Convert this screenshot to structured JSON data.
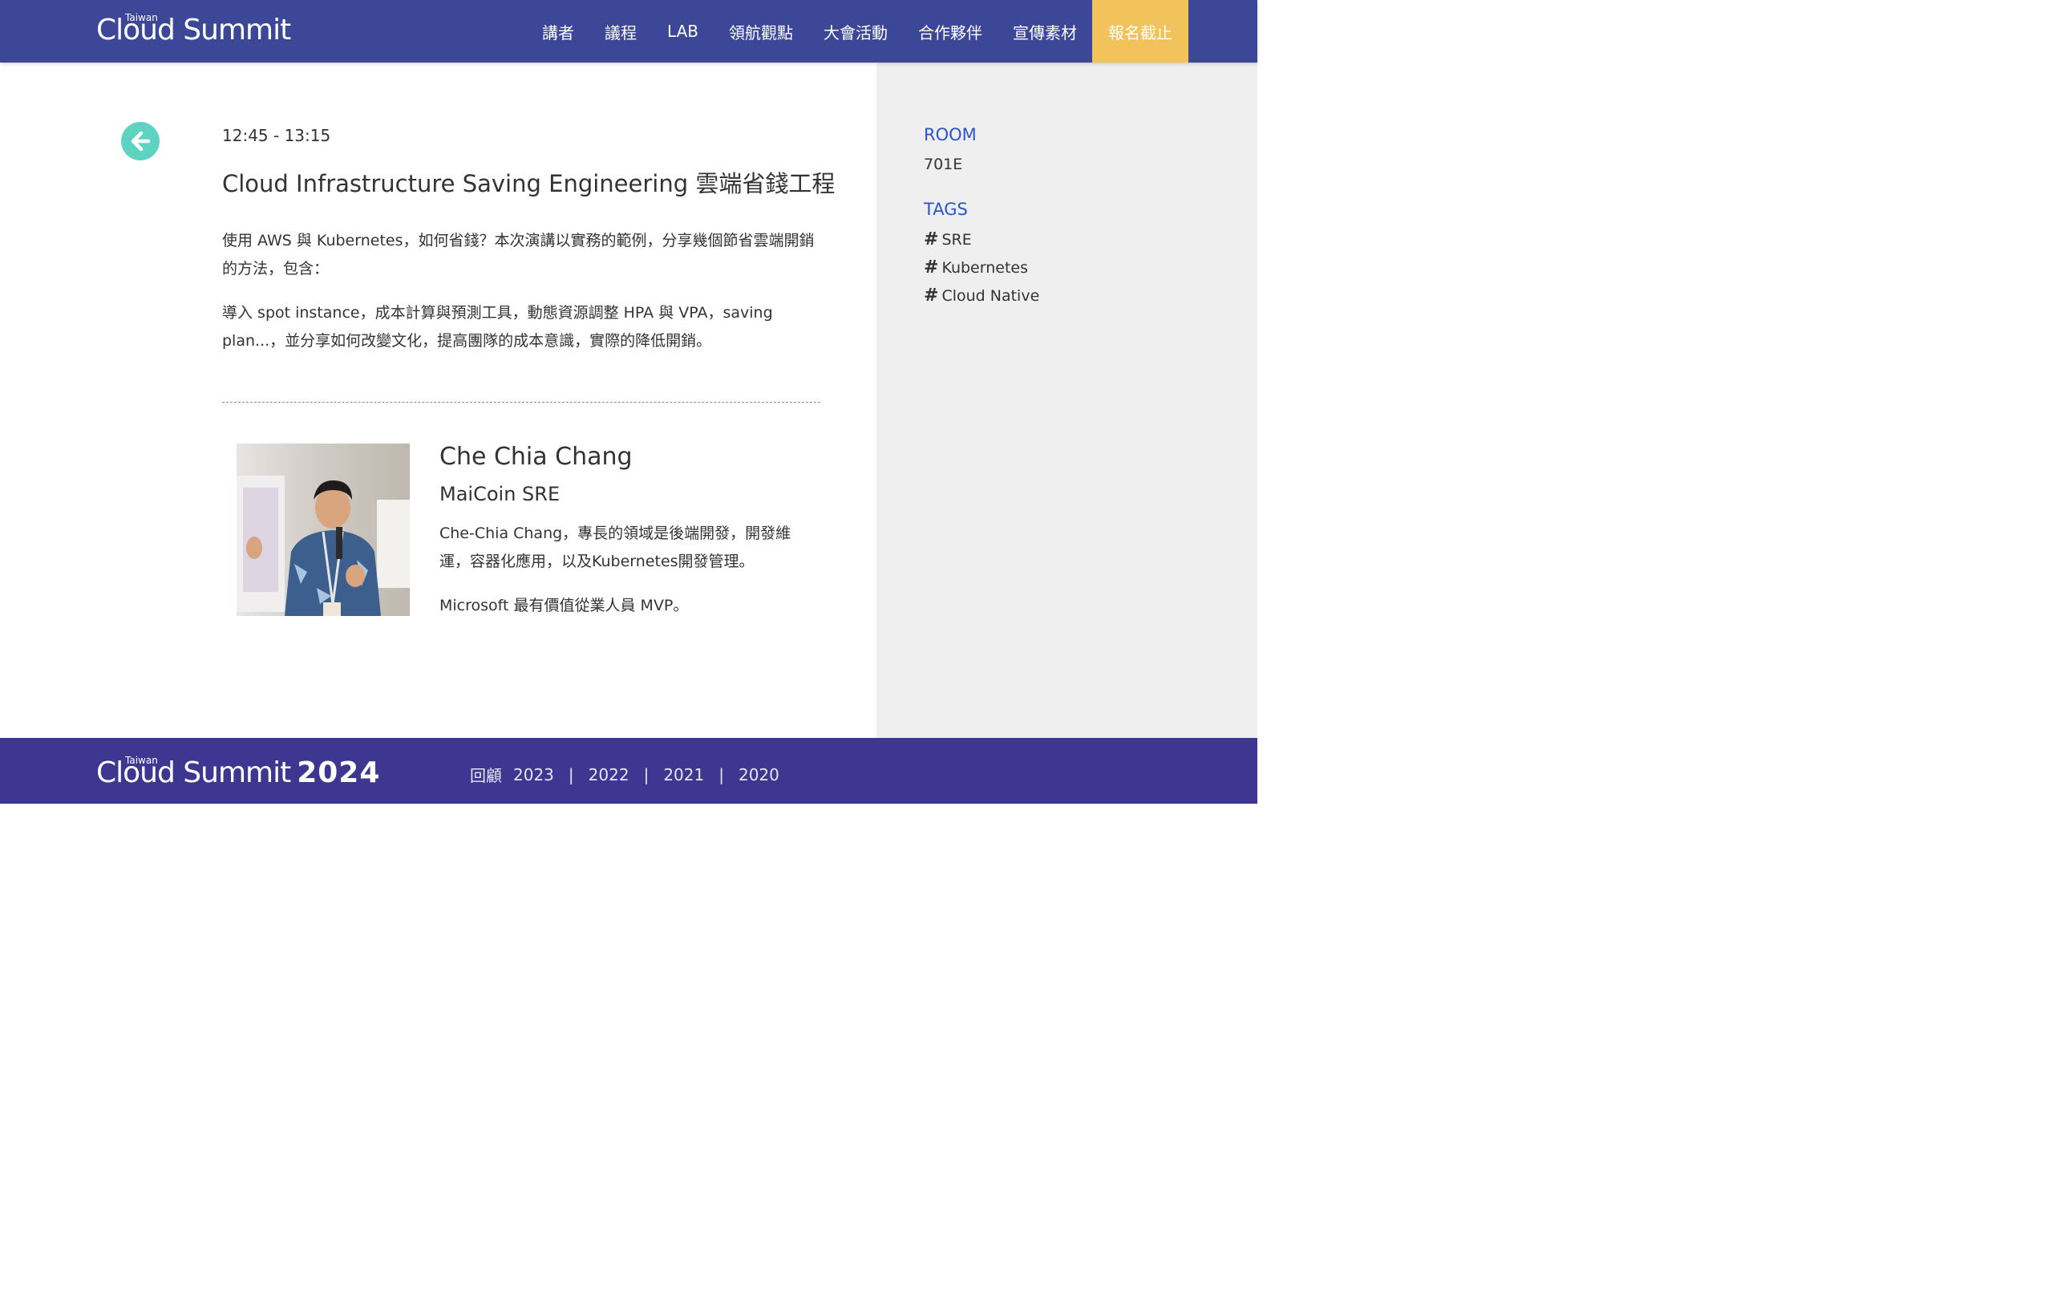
{
  "header": {
    "logo_small": "Taiwan",
    "logo_main": "Cloud Summit",
    "nav": [
      {
        "label": "講者"
      },
      {
        "label": "議程"
      },
      {
        "label": "LAB"
      },
      {
        "label": "領航觀點"
      },
      {
        "label": "大會活動"
      },
      {
        "label": "合作夥伴"
      },
      {
        "label": "宣傳素材"
      }
    ],
    "cta_label": "報名截止",
    "cta_color": "#f2c35b",
    "bg_color": "#3d4797"
  },
  "session": {
    "time": "12:45 - 13:15",
    "title": "Cloud Infrastructure Saving Engineering 雲端省錢工程",
    "paragraphs": [
      "使用 AWS 與 Kubernetes，如何省錢？本次演講以實務的範例，分享幾個節省雲端開銷的方法，包含：",
      "導入 spot instance，成本計算與預測工具，動態資源調整 HPA 與 VPA，saving plan...，並分享如何改變文化，提高團隊的成本意識，實際的降低開銷。"
    ]
  },
  "speaker": {
    "name": "Che Chia Chang",
    "company": "MaiCoin SRE",
    "bio": [
      "Che-Chia Chang，專長的領域是後端開發，開發維運，容器化應用，以及Kubernetes開發管理。",
      "Microsoft 最有價值從業人員 MVP。"
    ]
  },
  "sidebar": {
    "room_label": "ROOM",
    "room_value": "701E",
    "tags_label": "TAGS",
    "tags": [
      "SRE",
      "Kubernetes",
      "Cloud Native"
    ],
    "accent_color": "#2a55c9"
  },
  "footer": {
    "logo_small": "Taiwan",
    "logo_main": "Cloud Summit",
    "logo_year": "2024",
    "archive_label": "回顧",
    "years": [
      "2023",
      "2022",
      "2021",
      "2020"
    ],
    "separator": "|"
  }
}
